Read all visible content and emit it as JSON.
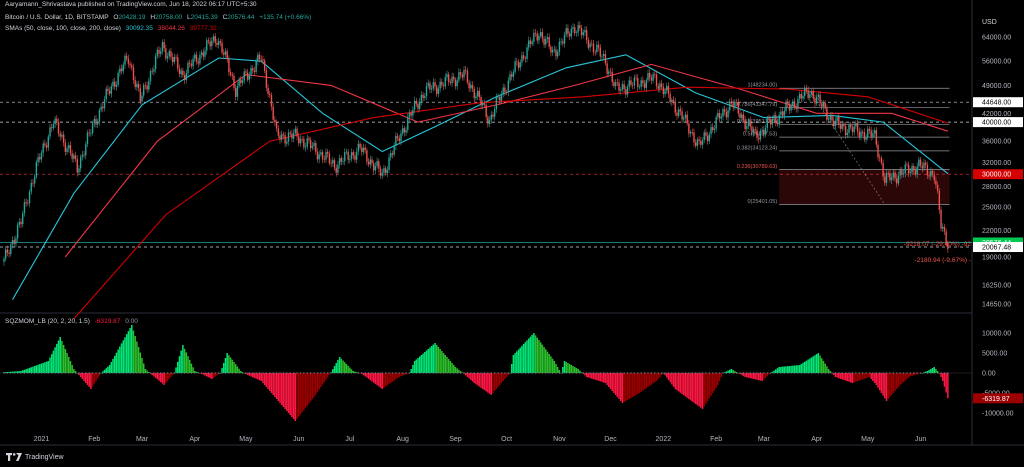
{
  "publisher": "Aaryamann_Shrivastava published on TradingView.com, Jun 18, 2022 06:17 UTC+5:30",
  "legend": {
    "symbol": "Bitcoin / U.S. Dollar, 1D, BITSTAMP",
    "ohlc": [
      {
        "k": "O",
        "v": "20428.19"
      },
      {
        "k": "H",
        "v": "20758.00"
      },
      {
        "k": "L",
        "v": "20415.39"
      },
      {
        "k": "C",
        "v": "20576.44"
      }
    ],
    "change": "+135.74 (+0.66%)",
    "sma_label": "SMAs (50, close, 100, close, 200, close)",
    "sma_values": [
      "30092.35",
      "38044.26",
      "39777.32"
    ],
    "osc_label": "SQZMOM_LB (20, 2, 20, 1.5)",
    "osc_values": [
      "-6319.87",
      "0.00"
    ]
  },
  "colors": {
    "up": "#26a69a",
    "down": "#ef5350",
    "sma50": "#26c6da",
    "sma100": "#f23645",
    "sma200": "#d50000",
    "fib": "#9598a1",
    "osc_up": "#2bbf2b",
    "osc_up_light": "#00e676",
    "osc_down": "#ff1744",
    "osc_down_dark": "#9c0000"
  },
  "footer": {
    "brand": "TradingView",
    "icon": "tradingview-logo-icon"
  },
  "chart_data": {
    "type": "candlestick",
    "title": "Bitcoin / U.S. Dollar, 1D, BITSTAMP",
    "y_axis": {
      "label": "USD",
      "scale": "log",
      "ticks": [
        64000,
        56000,
        49000,
        42000,
        36000,
        32000,
        28000,
        25000,
        22000,
        19000,
        16250,
        14650
      ]
    },
    "x_ticks": [
      {
        "d": "2021-01-01",
        "label": "2021"
      },
      {
        "d": "2021-02-01",
        "label": "Feb"
      },
      {
        "d": "2021-03-01",
        "label": "Mar"
      },
      {
        "d": "2021-04-01",
        "label": "Apr"
      },
      {
        "d": "2021-05-01",
        "label": "May"
      },
      {
        "d": "2021-06-01",
        "label": "Jun"
      },
      {
        "d": "2021-07-01",
        "label": "Jul"
      },
      {
        "d": "2021-08-01",
        "label": "Aug"
      },
      {
        "d": "2021-09-01",
        "label": "Sep"
      },
      {
        "d": "2021-10-01",
        "label": "Oct"
      },
      {
        "d": "2021-11-01",
        "label": "Nov"
      },
      {
        "d": "2021-12-01",
        "label": "Dec"
      },
      {
        "d": "2022-01-01",
        "label": "2022"
      },
      {
        "d": "2022-02-01",
        "label": "Feb"
      },
      {
        "d": "2022-03-01",
        "label": "Mar"
      },
      {
        "d": "2022-04-01",
        "label": "Apr"
      },
      {
        "d": "2022-05-01",
        "label": "May"
      },
      {
        "d": "2022-06-01",
        "label": "Jun"
      }
    ],
    "price_path": [
      [
        "2020-12-10",
        18500
      ],
      [
        "2020-12-20",
        23000
      ],
      [
        "2021-01-08",
        40000
      ],
      [
        "2021-01-22",
        31000
      ],
      [
        "2021-02-08",
        46000
      ],
      [
        "2021-02-21",
        57000
      ],
      [
        "2021-02-28",
        45000
      ],
      [
        "2021-03-13",
        61000
      ],
      [
        "2021-03-25",
        52000
      ],
      [
        "2021-04-14",
        64000
      ],
      [
        "2021-04-25",
        48000
      ],
      [
        "2021-05-10",
        57000
      ],
      [
        "2021-05-19",
        37000
      ],
      [
        "2021-05-31",
        37000
      ],
      [
        "2021-06-22",
        31500
      ],
      [
        "2021-07-07",
        34500
      ],
      [
        "2021-07-20",
        29800
      ],
      [
        "2021-08-14",
        47500
      ],
      [
        "2021-09-06",
        52000
      ],
      [
        "2021-09-21",
        40500
      ],
      [
        "2021-10-20",
        66000
      ],
      [
        "2021-10-28",
        58500
      ],
      [
        "2021-11-10",
        68000
      ],
      [
        "2021-11-28",
        56000
      ],
      [
        "2021-12-04",
        48000
      ],
      [
        "2021-12-27",
        51000
      ],
      [
        "2022-01-22",
        35000
      ],
      [
        "2022-02-10",
        44500
      ],
      [
        "2022-02-24",
        37000
      ],
      [
        "2022-03-28",
        47500
      ],
      [
        "2022-04-12",
        39500
      ],
      [
        "2022-05-05",
        37000
      ],
      [
        "2022-05-11",
        29000
      ],
      [
        "2022-05-31",
        31500
      ],
      [
        "2022-06-09",
        30000
      ],
      [
        "2022-06-13",
        22500
      ],
      [
        "2022-06-17",
        20576
      ]
    ],
    "sma_series": [
      {
        "name": "SMA 50",
        "color": "#26c6da",
        "points": [
          [
            "2020-12-15",
            15000
          ],
          [
            "2021-01-20",
            27000
          ],
          [
            "2021-03-01",
            44000
          ],
          [
            "2021-04-15",
            57000
          ],
          [
            "2021-05-10",
            56000
          ],
          [
            "2021-06-15",
            42000
          ],
          [
            "2021-07-20",
            34000
          ],
          [
            "2021-08-20",
            39000
          ],
          [
            "2021-09-25",
            46000
          ],
          [
            "2021-11-05",
            54000
          ],
          [
            "2021-12-10",
            58000
          ],
          [
            "2022-01-20",
            47000
          ],
          [
            "2022-03-01",
            41000
          ],
          [
            "2022-04-10",
            41500
          ],
          [
            "2022-05-10",
            40000
          ],
          [
            "2022-06-17",
            30092
          ]
        ]
      },
      {
        "name": "SMA 100",
        "color": "#f23645",
        "points": [
          [
            "2021-01-15",
            19000
          ],
          [
            "2021-03-10",
            36000
          ],
          [
            "2021-05-01",
            52000
          ],
          [
            "2021-06-20",
            49000
          ],
          [
            "2021-08-10",
            40000
          ],
          [
            "2021-09-25",
            44000
          ],
          [
            "2021-11-10",
            49000
          ],
          [
            "2021-12-25",
            55000
          ],
          [
            "2022-02-15",
            48000
          ],
          [
            "2022-04-01",
            42000
          ],
          [
            "2022-05-15",
            42000
          ],
          [
            "2022-06-17",
            38044
          ]
        ]
      },
      {
        "name": "SMA 200",
        "color": "#d50000",
        "points": [
          [
            "2021-01-20",
            13500
          ],
          [
            "2021-03-15",
            24000
          ],
          [
            "2021-05-15",
            36000
          ],
          [
            "2021-07-15",
            41000
          ],
          [
            "2021-09-15",
            44500
          ],
          [
            "2021-11-15",
            46000
          ],
          [
            "2022-01-15",
            48500
          ],
          [
            "2022-03-15",
            48000
          ],
          [
            "2022-05-01",
            46000
          ],
          [
            "2022-06-17",
            39777
          ]
        ]
      }
    ],
    "horizontal_levels": [
      {
        "price": 44648,
        "label": "44648.00",
        "color": "#d1d4dc",
        "bg": "#ffffff",
        "fg": "#000000",
        "dash": true
      },
      {
        "price": 40000,
        "label": "40000.00",
        "color": "#d1d4dc",
        "bg": "#ffffff",
        "fg": "#000000",
        "dash": true
      },
      {
        "price": 30000,
        "label": "30000.00",
        "color": "#f23645",
        "bg": "#d50000",
        "fg": "#ffffff",
        "dash": true
      },
      {
        "price": 20576.44,
        "label": "20576.44",
        "color": "#26a69a",
        "bg": "#00c853",
        "fg": "#ffffff",
        "dash": false
      },
      {
        "price": 20067.48,
        "label": "20067.48",
        "color": "#d1d4dc",
        "bg": "#ffffff",
        "fg": "#000000",
        "dash": true
      }
    ],
    "fib_levels": [
      {
        "ratio": "1",
        "price": 48234.0,
        "label": "1(48234.00)"
      },
      {
        "ratio": "0.786",
        "price": 43347.79,
        "label": "0.786(43347.79)"
      },
      {
        "ratio": "0.618",
        "price": 39517.53,
        "label": "0.618(39517.53)"
      },
      {
        "ratio": "0.5",
        "price": 36817.53,
        "label": "0.5(36817.53)"
      },
      {
        "ratio": "0.382",
        "price": 34123.24,
        "label": "0.382(34123.24)"
      },
      {
        "ratio": "0.236",
        "price": 30789.63,
        "label": "0.236(30789.63)"
      },
      {
        "ratio": "0",
        "price": 25401.05,
        "label": "0(25401.05)"
      }
    ],
    "fib_range": {
      "from": "2022-03-10",
      "to": "2022-06-18"
    },
    "measure_labels": [
      {
        "text": "-9218.07 (-29.40%) -92",
        "price": 20400
      },
      {
        "text": "-2180.94 (-9.67%) -",
        "price": 18700
      }
    ],
    "oscillator": {
      "name": "SQZMOM_LB",
      "ticks": [
        10000,
        5000,
        0,
        -5000,
        -10000
      ],
      "tick_labels": [
        "10000.00",
        "5000.00",
        "0.00",
        "-5000.00",
        "-10000.00"
      ],
      "value_label": "-6319.87",
      "zero_label": "0.00",
      "path": [
        [
          "2020-12-10",
          200
        ],
        [
          "2020-12-20",
          500
        ],
        [
          "2021-01-05",
          3000
        ],
        [
          "2021-01-12",
          9000
        ],
        [
          "2021-01-20",
          1000
        ],
        [
          "2021-01-24",
          -1000
        ],
        [
          "2021-01-30",
          -4000
        ],
        [
          "2021-02-05",
          0
        ],
        [
          "2021-02-10",
          2000
        ],
        [
          "2021-02-23",
          12000
        ],
        [
          "2021-03-03",
          1000
        ],
        [
          "2021-03-07",
          -500
        ],
        [
          "2021-03-14",
          -3000
        ],
        [
          "2021-03-20",
          0
        ],
        [
          "2021-03-25",
          7000
        ],
        [
          "2021-04-01",
          500
        ],
        [
          "2021-04-05",
          -200
        ],
        [
          "2021-04-11",
          -1500
        ],
        [
          "2021-04-16",
          0
        ],
        [
          "2021-04-20",
          5000
        ],
        [
          "2021-04-28",
          500
        ],
        [
          "2021-05-02",
          -500
        ],
        [
          "2021-05-10",
          -2000
        ],
        [
          "2021-05-18",
          -6000
        ],
        [
          "2021-05-30",
          -12000
        ],
        [
          "2021-06-10",
          -6000
        ],
        [
          "2021-06-20",
          200
        ],
        [
          "2021-06-25",
          4000
        ],
        [
          "2021-07-03",
          500
        ],
        [
          "2021-07-08",
          -200
        ],
        [
          "2021-07-20",
          -4000
        ],
        [
          "2021-07-30",
          -1000
        ],
        [
          "2021-08-05",
          0
        ],
        [
          "2021-08-08",
          3000
        ],
        [
          "2021-08-20",
          7500
        ],
        [
          "2021-09-01",
          1500
        ],
        [
          "2021-09-06",
          -200
        ],
        [
          "2021-09-12",
          -2500
        ],
        [
          "2021-09-22",
          -5500
        ],
        [
          "2021-09-30",
          -1500
        ],
        [
          "2021-10-03",
          0
        ],
        [
          "2021-10-05",
          4500
        ],
        [
          "2021-10-17",
          10000
        ],
        [
          "2021-10-29",
          3000
        ],
        [
          "2021-11-02",
          0
        ],
        [
          "2021-11-04",
          3000
        ],
        [
          "2021-11-12",
          1000
        ],
        [
          "2021-11-17",
          -1000
        ],
        [
          "2021-11-28",
          -2500
        ],
        [
          "2021-12-08",
          -7500
        ],
        [
          "2021-12-18",
          -5000
        ],
        [
          "2021-12-28",
          -2000
        ],
        [
          "2022-01-01",
          0
        ],
        [
          "2022-01-08",
          -4000
        ],
        [
          "2022-01-24",
          -9000
        ],
        [
          "2022-02-02",
          -3000
        ],
        [
          "2022-02-05",
          0
        ],
        [
          "2022-02-10",
          1000
        ],
        [
          "2022-02-18",
          -1000
        ],
        [
          "2022-02-28",
          -2000
        ],
        [
          "2022-03-05",
          0
        ],
        [
          "2022-03-10",
          1500
        ],
        [
          "2022-03-22",
          2000
        ],
        [
          "2022-04-02",
          5000
        ],
        [
          "2022-04-08",
          1000
        ],
        [
          "2022-04-12",
          -1000
        ],
        [
          "2022-04-22",
          -2500
        ],
        [
          "2022-05-02",
          -1000
        ],
        [
          "2022-05-06",
          -3000
        ],
        [
          "2022-05-12",
          -7000
        ],
        [
          "2022-05-20",
          -3000
        ],
        [
          "2022-05-26",
          -800
        ],
        [
          "2022-06-02",
          0
        ],
        [
          "2022-06-05",
          500
        ],
        [
          "2022-06-09",
          1500
        ],
        [
          "2022-06-12",
          0
        ],
        [
          "2022-06-14",
          -2000
        ],
        [
          "2022-06-17",
          -6320
        ]
      ]
    }
  }
}
